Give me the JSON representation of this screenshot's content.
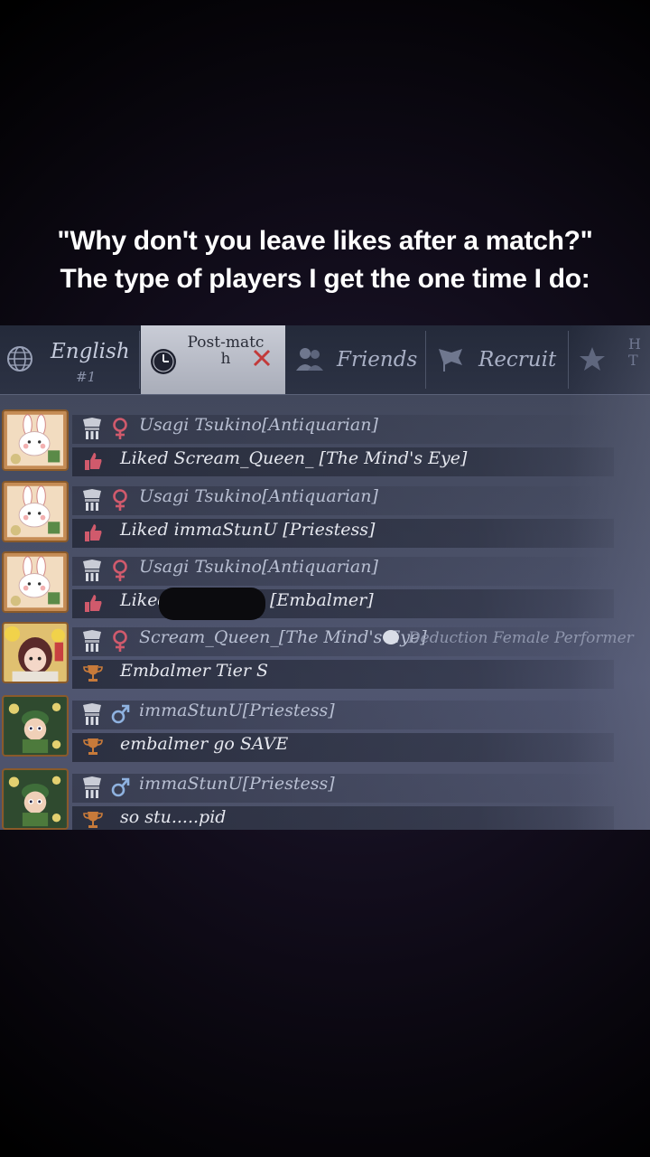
{
  "caption": {
    "line1": "\"Why don't you leave likes after a match?\"",
    "line2": "The type of players I get the one time I do:"
  },
  "tabs": {
    "english": {
      "label": "English",
      "sub": "#1",
      "icon": "globe-icon"
    },
    "postmatch": {
      "label": "Post-matc h",
      "icon": "clock-icon"
    },
    "friends": {
      "label": "Friends",
      "icon": "friends-icon"
    },
    "recruit": {
      "label": "Recruit",
      "icon": "flag-icon"
    },
    "extra": {
      "label": "H T",
      "icon": "team-icon"
    }
  },
  "messages": [
    {
      "name": "Usagi Tsukino[Antiquarian]",
      "gender": "female",
      "text": "Liked Scream_Queen_ [The Mind's Eye]",
      "icon": "thumbs-up-icon"
    },
    {
      "name": "Usagi Tsukino[Antiquarian]",
      "gender": "female",
      "text": "Liked immaStunU [Priestess]",
      "icon": "thumbs-up-icon"
    },
    {
      "name": "Usagi Tsukino[Antiquarian]",
      "gender": "female",
      "text": "Liked",
      "text_after": "[Embalmer]",
      "icon": "thumbs-up-icon"
    },
    {
      "name": "Scream_Queen_[The Mind's Eye]",
      "gender": "female",
      "tag": "Deduction Female Performer",
      "text": "Embalmer Tier S",
      "icon": "trophy-icon"
    },
    {
      "name": "immaStunU[Priestess]",
      "gender": "male",
      "text": "embalmer go SAVE",
      "icon": "trophy-icon"
    },
    {
      "name": "immaStunU[Priestess]",
      "gender": "male",
      "text": "so stu.....pid",
      "icon": "trophy-icon"
    }
  ],
  "colors": {
    "female": "#d05a6c",
    "male": "#8fb2e0",
    "thumb": "#d05a6c",
    "trophy": "#c77a3a"
  }
}
